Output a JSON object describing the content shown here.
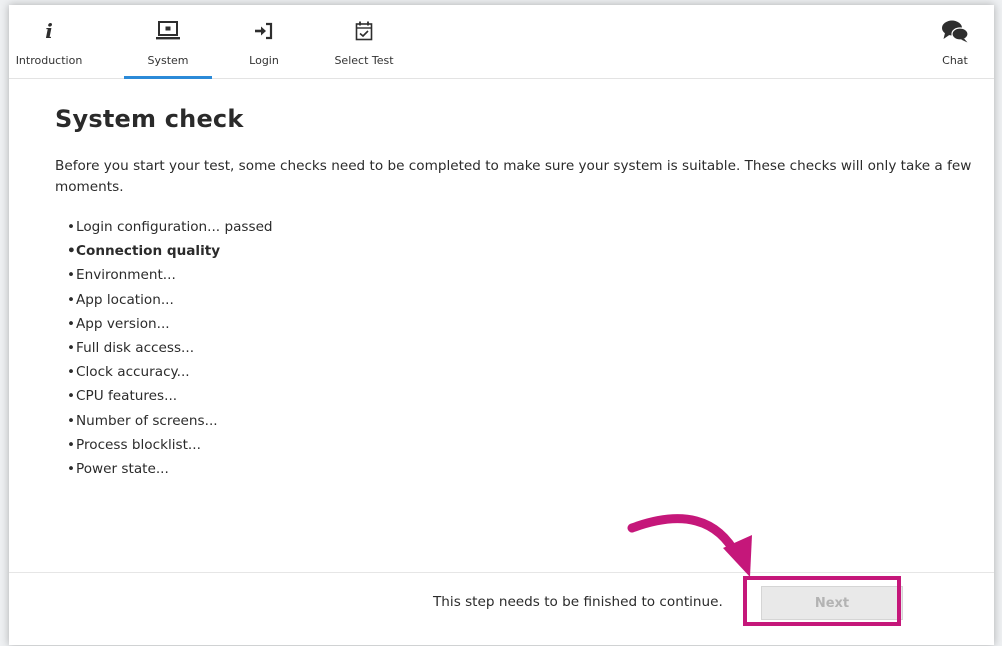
{
  "tabs": [
    {
      "label": "Introduction",
      "icon": "info-icon"
    },
    {
      "label": "System",
      "icon": "laptop-icon",
      "active": true
    },
    {
      "label": "Login",
      "icon": "login-icon"
    },
    {
      "label": "Select Test",
      "icon": "calendar-check-icon"
    }
  ],
  "chat": {
    "label": "Chat",
    "icon": "chat-bubbles-icon"
  },
  "page": {
    "title": "System check",
    "intro": "Before you start your test, some checks need to be completed to make sure your system is suitable. These checks will only take a few moments."
  },
  "checks": [
    {
      "text": "Login configuration... passed",
      "state": "passed"
    },
    {
      "text": "Connection quality",
      "state": "active"
    },
    {
      "text": "Environment...",
      "state": "pending"
    },
    {
      "text": "App location...",
      "state": "pending"
    },
    {
      "text": "App version...",
      "state": "pending"
    },
    {
      "text": "Full disk access...",
      "state": "pending"
    },
    {
      "text": "Clock accuracy...",
      "state": "pending"
    },
    {
      "text": "CPU features...",
      "state": "pending"
    },
    {
      "text": "Number of screens...",
      "state": "pending"
    },
    {
      "text": "Process blocklist...",
      "state": "pending"
    },
    {
      "text": "Power state...",
      "state": "pending"
    }
  ],
  "footer": {
    "message": "This step needs to be finished to continue.",
    "next_label": "Next",
    "next_enabled": false
  },
  "colors": {
    "accent_underline": "#2b8ad8",
    "highlight": "#c5177a",
    "disabled_bg": "#e9e9e9",
    "disabled_text": "#b3b3b3"
  }
}
